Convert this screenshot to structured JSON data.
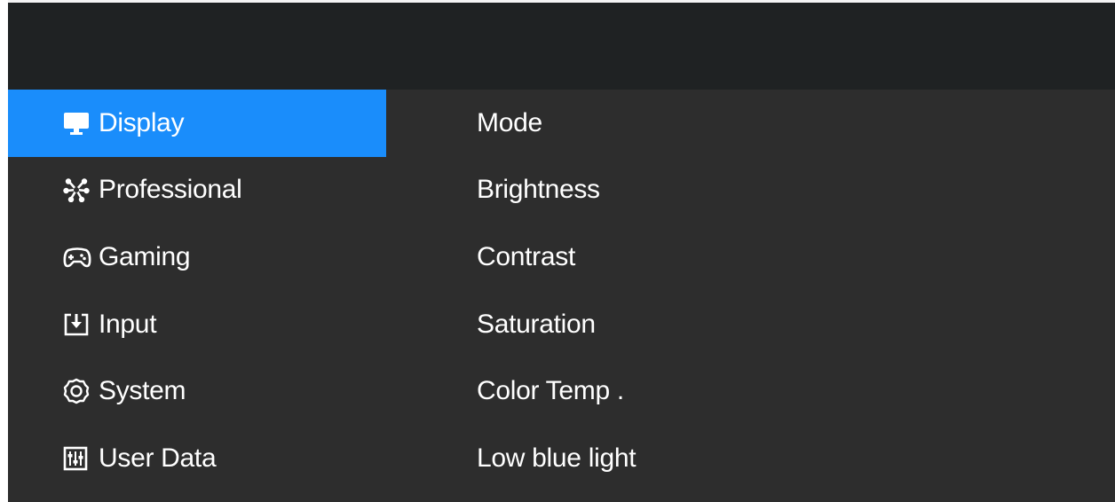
{
  "colors": {
    "background": "#2d2d2d",
    "header": "#1f2223",
    "accent": "#1a8dfb",
    "text": "#ffffff"
  },
  "menu": {
    "items": [
      {
        "label": "Display",
        "icon": "monitor-icon",
        "active": true
      },
      {
        "label": "Professional",
        "icon": "color-wheel-icon",
        "active": false
      },
      {
        "label": "Gaming",
        "icon": "gamepad-icon",
        "active": false
      },
      {
        "label": "Input",
        "icon": "input-icon",
        "active": false
      },
      {
        "label": "System",
        "icon": "gear-icon",
        "active": false
      },
      {
        "label": "User Data",
        "icon": "sliders-icon",
        "active": false
      }
    ]
  },
  "submenu": {
    "items": [
      {
        "label": "Mode"
      },
      {
        "label": "Brightness"
      },
      {
        "label": "Contrast"
      },
      {
        "label": "Saturation"
      },
      {
        "label": "Color Temp ."
      },
      {
        "label": "Low blue light"
      }
    ]
  }
}
